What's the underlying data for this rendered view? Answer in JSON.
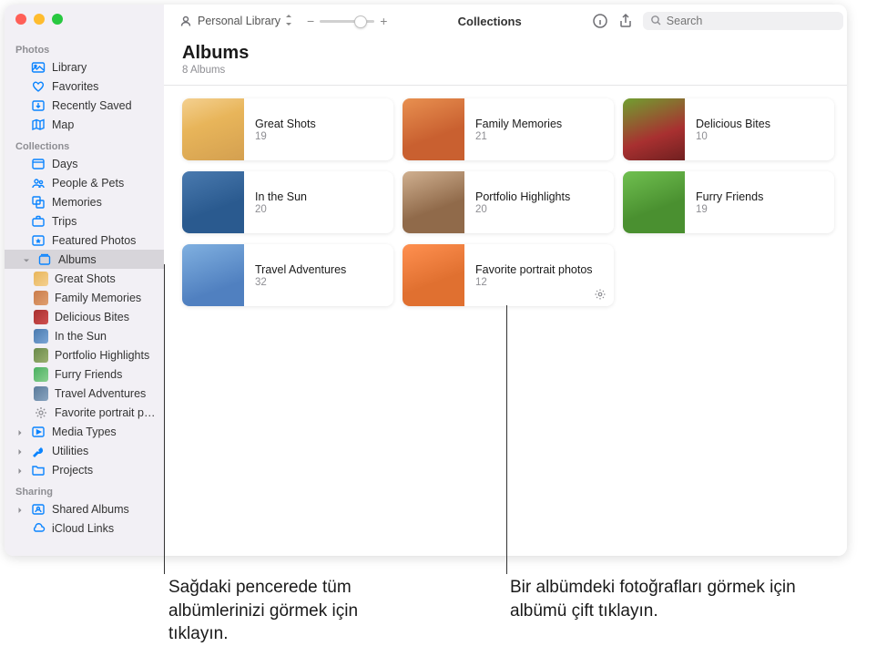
{
  "toolbar": {
    "library_label": "Personal Library",
    "center_title": "Collections",
    "search_placeholder": "Search"
  },
  "header": {
    "title": "Albums",
    "subtitle": "8 Albums"
  },
  "sidebar": {
    "sections": {
      "photos": "Photos",
      "collections": "Collections",
      "sharing": "Sharing"
    },
    "photos": [
      {
        "label": "Library"
      },
      {
        "label": "Favorites"
      },
      {
        "label": "Recently Saved"
      },
      {
        "label": "Map"
      }
    ],
    "collections": [
      {
        "label": "Days"
      },
      {
        "label": "People & Pets"
      },
      {
        "label": "Memories"
      },
      {
        "label": "Trips"
      },
      {
        "label": "Featured Photos"
      },
      {
        "label": "Albums"
      },
      {
        "label": "Media Types"
      },
      {
        "label": "Utilities"
      },
      {
        "label": "Projects"
      }
    ],
    "album_children": [
      {
        "label": "Great Shots"
      },
      {
        "label": "Family Memories"
      },
      {
        "label": "Delicious Bites"
      },
      {
        "label": "In the Sun"
      },
      {
        "label": "Portfolio Highlights"
      },
      {
        "label": "Furry Friends"
      },
      {
        "label": "Travel Adventures"
      },
      {
        "label": "Favorite portrait photos"
      }
    ],
    "sharing": [
      {
        "label": "Shared Albums"
      },
      {
        "label": "iCloud Links"
      }
    ]
  },
  "albums": [
    {
      "title": "Great Shots",
      "count": "19"
    },
    {
      "title": "Family Memories",
      "count": "21"
    },
    {
      "title": "Delicious Bites",
      "count": "10"
    },
    {
      "title": "In the Sun",
      "count": "20"
    },
    {
      "title": "Portfolio Highlights",
      "count": "20"
    },
    {
      "title": "Furry Friends",
      "count": "19"
    },
    {
      "title": "Travel Adventures",
      "count": "32"
    },
    {
      "title": "Favorite portrait photos",
      "count": "12"
    }
  ],
  "callouts": {
    "left": "Sağdaki pencerede tüm albümlerinizi görmek için tıklayın.",
    "right": "Bir albümdeki fotoğrafları görmek için albümü çift tıklayın."
  }
}
